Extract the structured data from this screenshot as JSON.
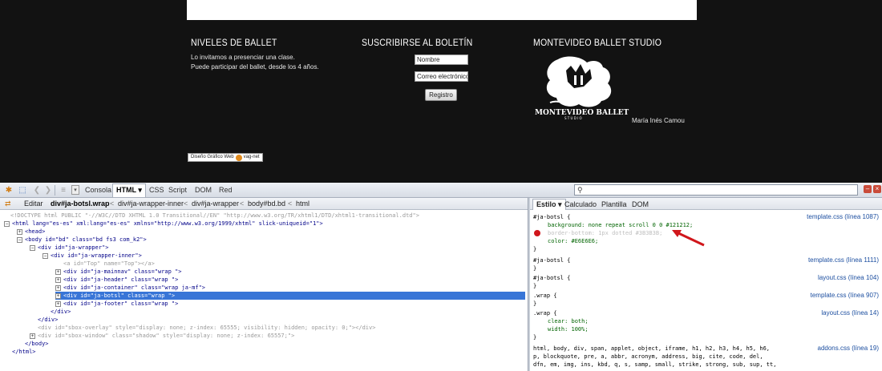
{
  "site": {
    "col1": {
      "title": "NIVELES DE BALLET",
      "line1": "Lo invitamos a presenciar una clase.",
      "line2": "Puede participar del ballet, desde los 4 años."
    },
    "col2": {
      "title": "SUSCRIBIRSE AL BOLETÍN",
      "name_value": "Nombre",
      "email_value": "Correo electrónico",
      "button": "Registro"
    },
    "col3": {
      "title": "MONTEVIDEO BALLET STUDIO",
      "logo_text": "MONTEVIDEO BALLET",
      "logo_subtext": "S T U D I O",
      "person": "María Inés Camou"
    },
    "credit": {
      "label": "Diseño Gráfico Web",
      "brand": "vag-net"
    }
  },
  "firebug": {
    "tabs": [
      "Consola",
      "HTML",
      "CSS",
      "Script",
      "DOM",
      "Red"
    ],
    "edit_label": "Editar",
    "breadcrumb": [
      "div#ja-botsl.wrap",
      "div#ja-wrapper-inner",
      "div#ja-wrapper",
      "body#bd.bd",
      "html"
    ],
    "side_tabs": [
      "Estilo",
      "Calculado",
      "Plantilla",
      "DOM"
    ],
    "html_tree": [
      "<!DOCTYPE html PUBLIC \"-//W3C//DTD XHTML 1.0 Transitional//EN\" \"http://www.w3.org/TR/xhtml1/DTD/xhtml1-transitional.dtd\">",
      "<html lang=\"es-es\" xml:lang=\"es-es\" xmlns=\"http://www.w3.org/1999/xhtml\" slick-uniqueid=\"1\">",
      "<head>",
      "<body id=\"bd\" class=\"bd fs3 com_k2\">",
      "<div id=\"ja-wrapper\">",
      "<div id=\"ja-wrapper-inner\">",
      "<a id=\"Top\" name=\"Top\"></a>",
      "<div id=\"ja-mainnav\" class=\"wrap \">",
      "<div id=\"ja-header\" class=\"wrap \">",
      "<div id=\"ja-container\" class=\"wrap ja-mf\">",
      "<div id=\"ja-botsl\" class=\"wrap \">",
      "<div id=\"ja-footer\" class=\"wrap \">",
      "</div>",
      "</div>",
      "<div id=\"sbox-overlay\" style=\"display: none; z-index: 65555; visibility: hidden; opacity: 0;\"></div>",
      "<div id=\"sbox-window\" class=\"shadow\" style=\"display: none; z-index: 65557;\">",
      "</body>",
      "</html>"
    ],
    "css_rules": [
      "#ja-botsl {",
      "background: none repeat scroll 0 0 #121212;",
      "border-bottom: 1px dotted #3B3B3B;",
      "color: #E6E6E6;",
      "}",
      "#ja-botsl {",
      "}",
      "#ja-botsl {",
      "}",
      ".wrap {",
      "}",
      ".wrap {",
      "clear: both;",
      "width: 100%;",
      "}",
      "html, body, div, span, applet, object, iframe, h1, h2, h3, h4, h5, h6,",
      "p, blockquote, pre, a, abbr, acronym, address, big, cite, code, del,",
      "dfn, em, img, ins, kbd, q, s, samp, small, strike, strong, sub, sup, tt,"
    ],
    "css_sources": [
      "template.css (línea 1087)",
      "template.css (línea 1111)",
      "layout.css (línea 104)",
      "template.css (línea 907)",
      "layout.css (línea 14)",
      "addons.css (línea 19)"
    ]
  }
}
